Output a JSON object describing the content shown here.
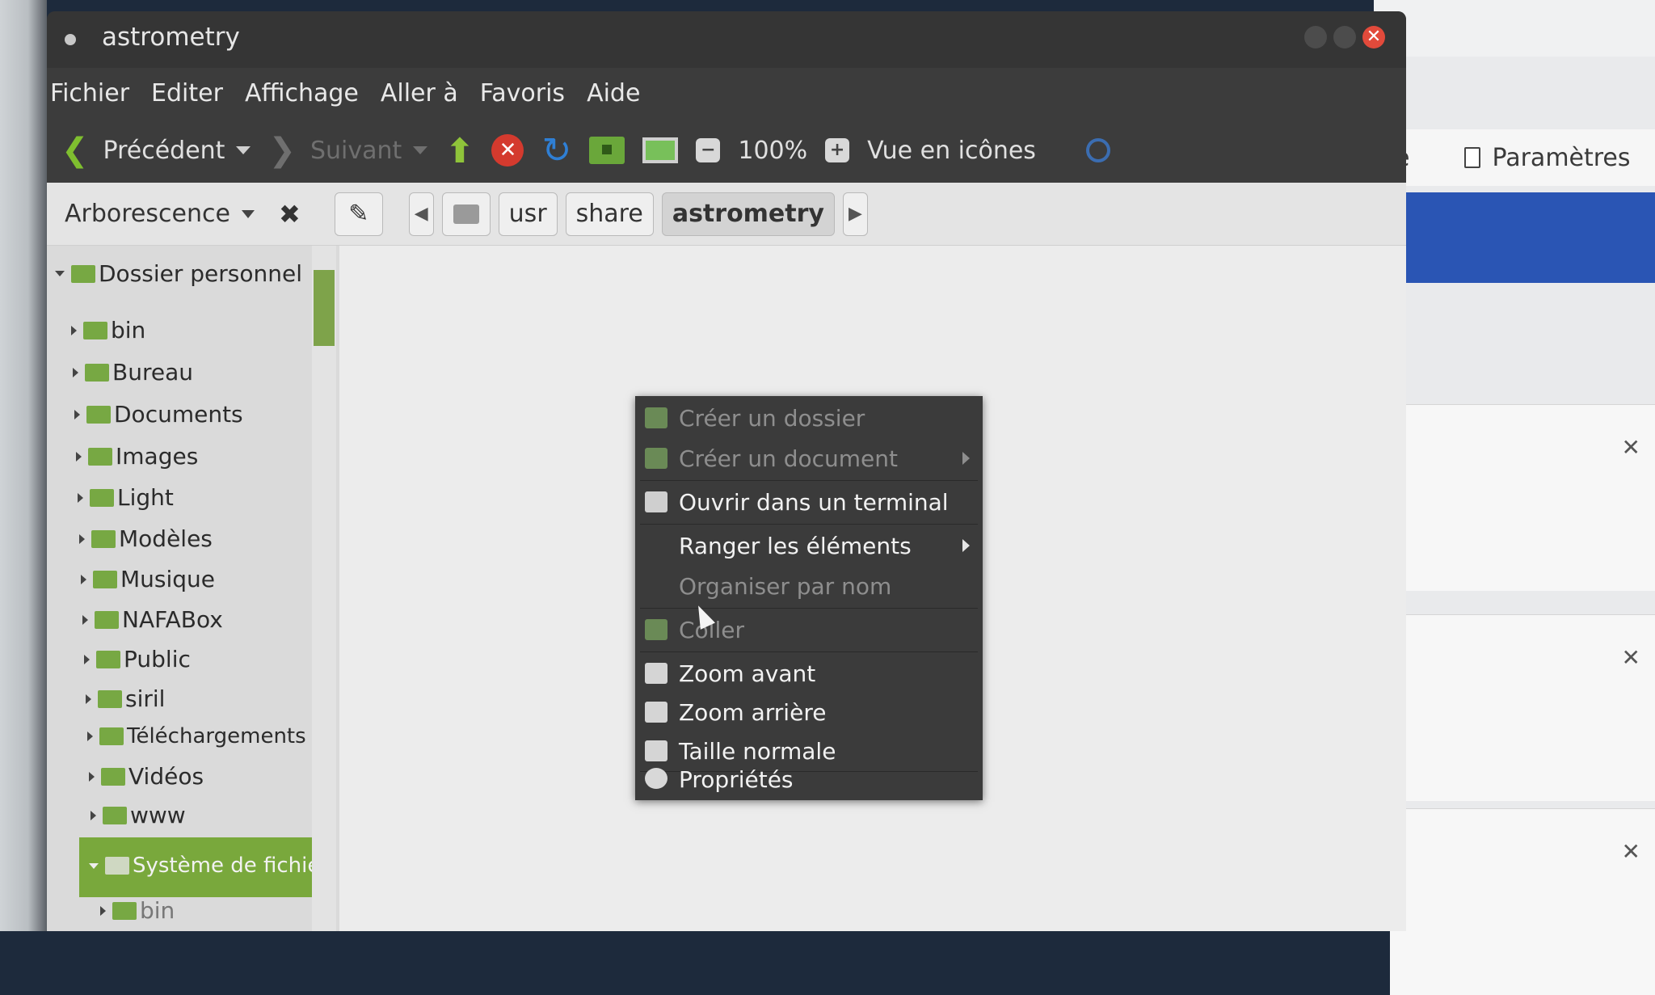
{
  "window": {
    "title": "astrometry"
  },
  "menubar": [
    "Fichier",
    "Editer",
    "Affichage",
    "Aller à",
    "Favoris",
    "Aide"
  ],
  "toolbar": {
    "back_label": "Précédent",
    "forward_label": "Suivant",
    "zoom_level": "100%",
    "view_mode": "Vue en icônes"
  },
  "location": {
    "sidebar_mode": "Arborescence",
    "crumbs": [
      "usr",
      "share",
      "astrometry"
    ]
  },
  "sidebar": {
    "root": "Dossier personnel",
    "items": [
      "bin",
      "Bureau",
      "Documents",
      "Images",
      "Light",
      "Modèles",
      "Musique",
      "NAFABox",
      "Public",
      "siril",
      "Téléchargements",
      "Vidéos",
      "www"
    ],
    "filesystem": "Système de fichier",
    "fs_child": "bin"
  },
  "context_menu": {
    "items": [
      {
        "label": "Créer un dossier",
        "disabled": true,
        "submenu": false
      },
      {
        "label": "Créer un document",
        "disabled": true,
        "submenu": true
      },
      {
        "label": "Ouvrir dans un terminal",
        "disabled": false,
        "submenu": false
      },
      {
        "label": "Ranger les éléments",
        "disabled": false,
        "submenu": true
      },
      {
        "label": "Organiser par nom",
        "disabled": true,
        "submenu": false
      },
      {
        "label": "Coller",
        "disabled": true,
        "submenu": false
      },
      {
        "label": "Zoom avant",
        "disabled": false,
        "submenu": false
      },
      {
        "label": "Zoom arrière",
        "disabled": false,
        "submenu": false
      },
      {
        "label": "Taille normale",
        "disabled": false,
        "submenu": false
      },
      {
        "label": "Propriétés",
        "disabled": false,
        "submenu": false
      }
    ]
  },
  "background_window": {
    "toolbar_partial": "e",
    "settings_label": "Paramètres"
  },
  "colors": {
    "accent": "#79a83c",
    "titlebar": "#353535",
    "menu_bg": "#3b3b3b",
    "blue_bar": "#2a55b4"
  }
}
